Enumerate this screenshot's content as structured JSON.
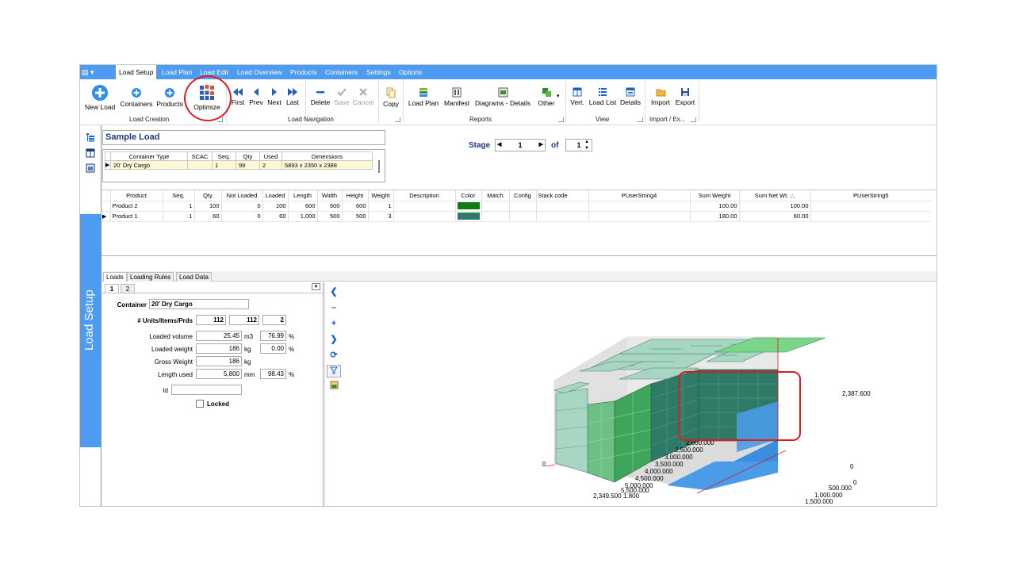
{
  "menu": {
    "app_icon": "▤ ▾",
    "tabs": [
      "Load Setup",
      "Load Plan",
      "Load Edit",
      "Load Overview",
      "Products",
      "Containers",
      "Settings",
      "Options"
    ]
  },
  "ribbon": {
    "load_creation": {
      "group": "Load Creation",
      "new_load": "New Load",
      "containers": "Containers",
      "products": "Products",
      "optimize": "Optimize"
    },
    "load_navigation": {
      "group": "Load Navigation",
      "first": "First",
      "prev": "Prev",
      "next": "Next",
      "last": "Last",
      "delete": "Delete",
      "save": "Save",
      "cancel": "Cancel",
      "copy": "Copy"
    },
    "reports": {
      "group": "Reports",
      "load_plan": "Load Plan",
      "manifest": "Manifest",
      "diagrams": "Diagrams - Details",
      "other": "Other"
    },
    "view": {
      "group": "View",
      "vert": "Vert.",
      "load_list": "Load List",
      "details": "Details"
    },
    "import_export": {
      "group": "Import / Ex...",
      "import": "Import",
      "export": "Export"
    }
  },
  "sidebar": {
    "title": "Load Setup"
  },
  "load": {
    "name": "Sample Load",
    "container_headers": [
      "Container Type",
      "SCAC",
      "Seq.",
      "Qty",
      "Used",
      "Dimensions"
    ],
    "container_rows": [
      [
        "20' Dry Cargo",
        "",
        "1",
        "99",
        "2",
        "5893 x 2350 x 2388"
      ]
    ]
  },
  "stage": {
    "label": "Stage",
    "value": "1",
    "of_label": "of",
    "total": "1"
  },
  "products": {
    "headers": [
      "Product",
      "Seq.",
      "Qty",
      "Not Loaded",
      "Loaded",
      "Length",
      "Width",
      "Height",
      "Weight",
      "Description",
      "Color",
      "Match",
      "Config",
      "Stack code",
      "PUserString4",
      "Sum Weight",
      "Sum Net Wt.",
      "PUserString5"
    ],
    "rows": [
      {
        "name": "Product 2",
        "seq": "1",
        "qty": "100",
        "not_loaded": "0",
        "loaded": "100",
        "length": "600",
        "width": "600",
        "height": "600",
        "weight": "1",
        "color": "#0f7a16",
        "sum_weight": "100.00",
        "sum_net": "100.00"
      },
      {
        "name": "Product 1",
        "seq": "1",
        "qty": "60",
        "not_loaded": "0",
        "loaded": "60",
        "length": "1,000",
        "width": "500",
        "height": "500",
        "weight": "3",
        "color": "#2f7a66",
        "sum_weight": "180.00",
        "sum_net": "60.00"
      }
    ]
  },
  "lower_tabs": [
    "Loads",
    "Loading Rules",
    "Load Data"
  ],
  "loads_panel": {
    "inner_tabs": [
      "1",
      "2"
    ],
    "container_label": "Container",
    "container_value": "20' Dry Cargo",
    "units_label": "# Units/Items/Prds",
    "units": "112",
    "items": "112",
    "prds": "2",
    "loaded_volume_label": "Loaded volume",
    "loaded_volume": "25.45",
    "loaded_volume_unit": "m3",
    "loaded_volume_pct": "76.99",
    "loaded_weight_label": "Loaded weight",
    "loaded_weight": "186",
    "loaded_weight_unit": "kg",
    "loaded_weight_pct": "0.00",
    "gross_weight_label": "Gross Weight",
    "gross_weight": "186",
    "gross_weight_unit": "kg",
    "length_used_label": "Length used",
    "length_used": "5,800",
    "length_used_unit": "mm",
    "length_used_pct": "98.43",
    "pct": "%",
    "id_label": "Id",
    "id_value": "",
    "locked_label": "Locked"
  },
  "viewer": {
    "height_label": "2,387.600",
    "axis_labels": [
      "0",
      "0",
      "500.000",
      "1,000.000",
      "1,500.000",
      "2,000.000",
      "2,500.000",
      "3,000.000",
      "3,500.000",
      "4,000.000",
      "4,500.000",
      "5,000.000",
      "5,500.000"
    ],
    "left_zero": "0",
    "corner_label": "2,349.500",
    "corner_label2": "1.800"
  }
}
